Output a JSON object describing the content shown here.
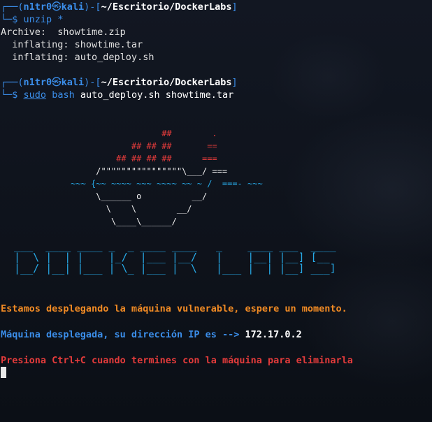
{
  "prompt": {
    "user": "n1tr0",
    "host": "kali",
    "path": "~/Escritorio/DockerLabs",
    "skull": "㉿",
    "corner_top": "┌──(",
    "corner_mid": ")-[",
    "corner_end": "]",
    "corner_bottom": "└─$"
  },
  "session": [
    {
      "command": "unzip *",
      "command_parts": [
        "unzip",
        "*"
      ],
      "output": [
        "Archive:  showtime.zip",
        "  inflating: showtime.tar",
        "  inflating: auto_deploy.sh"
      ]
    },
    {
      "command_parts": [
        "sudo",
        "bash",
        "auto_deploy.sh showtime.tar"
      ]
    }
  ],
  "docker_art": {
    "lines": [
      "                                ##        .",
      "                          ## ## ##       ==",
      "                       ## ## ## ##      ===",
      "                   /\"\"\"\"\"\"\"\"\"\"\"\"\"\"\"\"\\___/ ===",
      "              ~~~ {~~ ~~~~ ~~~ ~~~~ ~~ ~ /  ===- ~~~",
      "                   \\______ o          __/",
      "                     \\    \\        __/",
      "                      \\____\\______/"
    ]
  },
  "logo_art": {
    "lines": [
      "  ___  ____ ____ _  _ ____ ____   _    ____ ___  ____",
      "  |  \\ |  | |    |_/  |___ |__/   |    |__| |__] [__",
      "  |__/ |__| |___ | \\_ |___ |  \\   |___ |  | |__] ___]"
    ]
  },
  "messages": {
    "deploying": "Estamos desplegando la máquina vulnerable, espere un momento.",
    "deployed_label": "Máquina desplegada, su dirección IP es -->",
    "ip": "172.17.0.2",
    "exit_hint": "Presiona Ctrl+C cuando termines con la máquina para eliminarla"
  },
  "colors": {
    "background": "#0d1117",
    "prompt_blue": "#3b8eea",
    "orange": "#f08a24",
    "red": "#e33b3b",
    "cyan": "#27a9e6"
  }
}
